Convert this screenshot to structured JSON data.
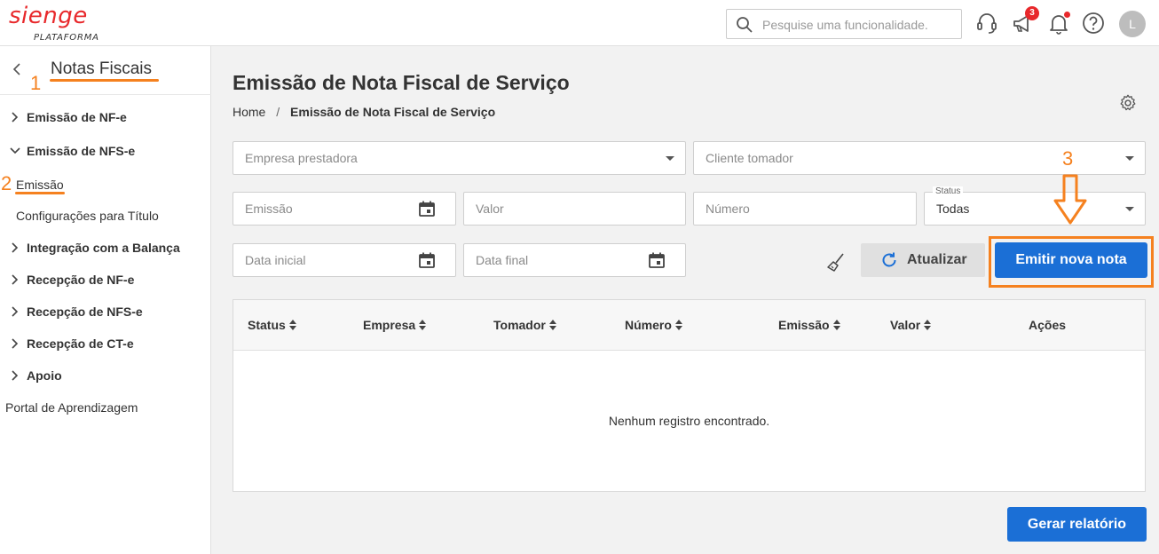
{
  "brand": {
    "logo_text": "sienge",
    "logo_sub": "PLATAFORMA",
    "color": "#e8282b"
  },
  "topbar": {
    "search_placeholder": "Pesquise uma funcionalidade.",
    "notifications_count": "3",
    "avatar_initial": "L",
    "icons": [
      "headset-icon",
      "megaphone-icon",
      "bell-icon",
      "help-icon"
    ]
  },
  "sidebar": {
    "title": "Notas Fiscais",
    "items": [
      {
        "label": "Emissão de NF-e"
      },
      {
        "label": "Emissão de NFS-e"
      },
      {
        "label": "Emissão"
      },
      {
        "label": "Configurações para Título"
      },
      {
        "label": "Integração com a Balança"
      },
      {
        "label": "Recepção de NF-e"
      },
      {
        "label": "Recepção de NFS-e"
      },
      {
        "label": "Recepção de CT-e"
      },
      {
        "label": "Apoio"
      },
      {
        "label": "Portal de Aprendizagem"
      }
    ]
  },
  "annotations": {
    "a1": "1",
    "a2": "2",
    "a3": "3",
    "color": "#f5811f"
  },
  "page": {
    "title": "Emissão de Nota Fiscal de Serviço",
    "breadcrumb": {
      "home": "Home",
      "separator": "/",
      "current": "Emissão de Nota Fiscal de Serviço"
    }
  },
  "filters": {
    "empresa": "Empresa prestadora",
    "cliente": "Cliente tomador",
    "emissao": "Emissão",
    "valor": "Valor",
    "numero": "Número",
    "status_label": "Status",
    "status_value": "Todas",
    "data_inicial": "Data inicial",
    "data_final": "Data final"
  },
  "actions": {
    "refresh": "Atualizar",
    "emit": "Emitir nova nota",
    "report": "Gerar relatório",
    "primary_color": "#1b6fd6"
  },
  "table": {
    "columns": [
      "Status",
      "Empresa",
      "Tomador",
      "Número",
      "Emissão",
      "Valor",
      "Ações"
    ],
    "empty_message": "Nenhum registro encontrado."
  }
}
